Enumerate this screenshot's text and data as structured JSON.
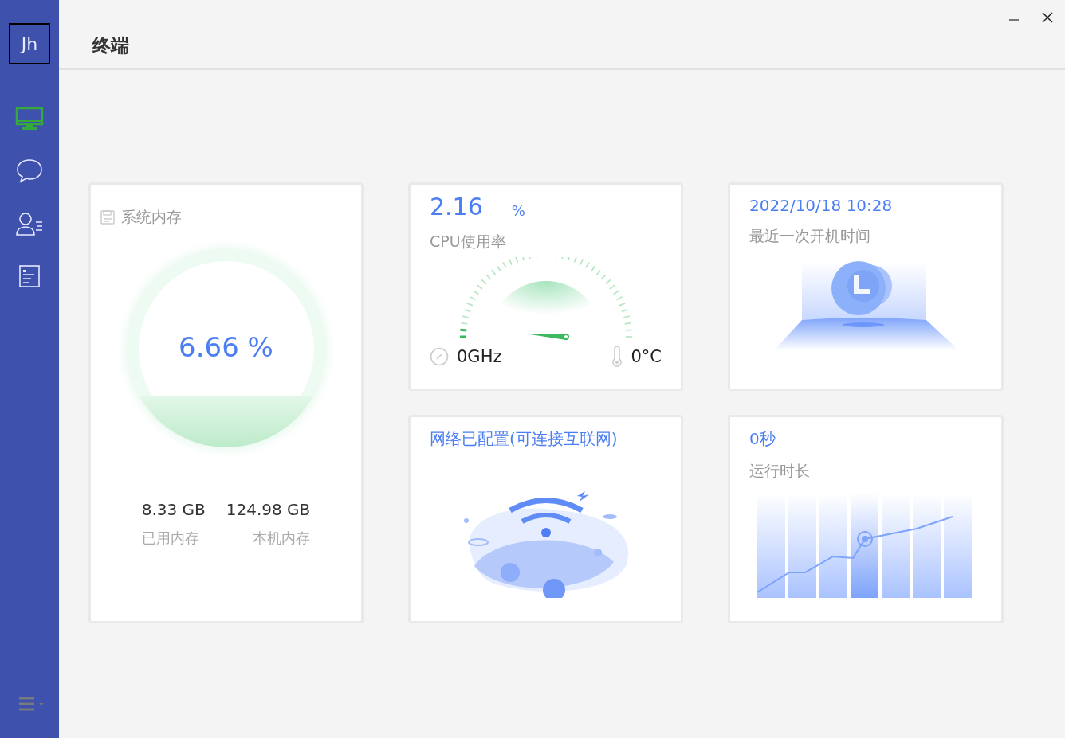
{
  "sidebar": {
    "avatar": "Jh",
    "items": [
      {
        "kind": "monitor",
        "selected": true
      },
      {
        "kind": "chat",
        "selected": false
      },
      {
        "kind": "user",
        "selected": false
      },
      {
        "kind": "document",
        "selected": false
      }
    ]
  },
  "window": {
    "title": "终端"
  },
  "memory": {
    "title": "系统内存",
    "reading": "6.66 %",
    "used": "8.33 GB",
    "used_label": "已用内存",
    "total": "124.98 GB",
    "total_label": "本机内存"
  },
  "cpu": {
    "value": "2.16",
    "unit": "%",
    "label": "CPU使用率",
    "frequency": "0GHz",
    "temperature": "0°C"
  },
  "boot": {
    "time": "2022/10/18 10:28",
    "label": "最近一次开机时间"
  },
  "network": {
    "status": "网络已配置(可连接互联网)"
  },
  "uptime": {
    "value": "0秒",
    "label": "运行时长"
  }
}
